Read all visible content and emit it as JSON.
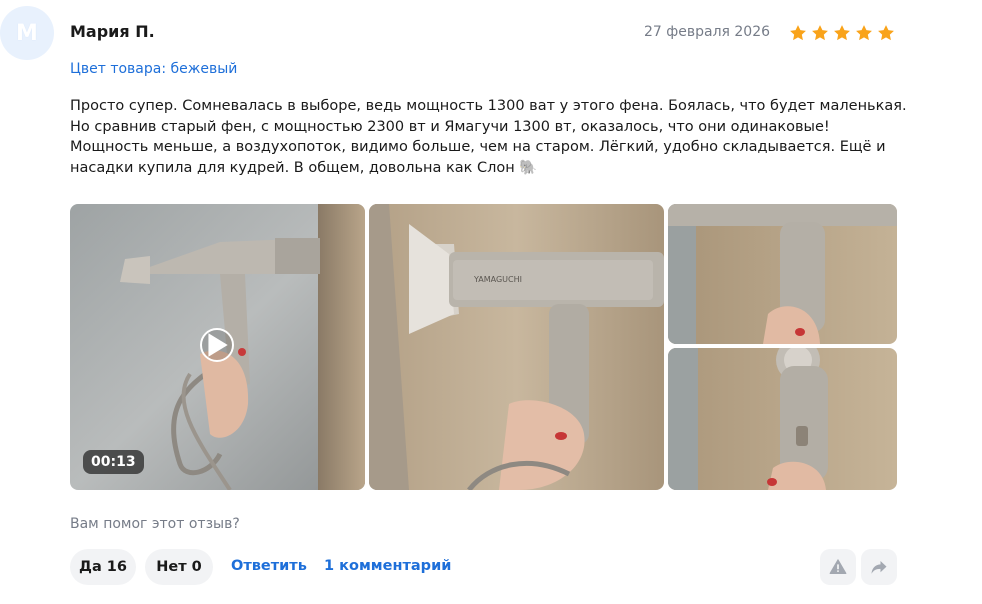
{
  "review": {
    "avatar_letter": "М",
    "author": "Мария П.",
    "date": "27 февраля 2026",
    "rating": 5,
    "color_label": "Цвет товара: бежевый",
    "text": "Просто супер. Сомневалась в выборе, ведь мощность 1300 ват у этого фена. Боялась, что будет маленькая. Но сравнив старый фен, с мощностью 2300 вт и Ямагучи 1300 вт, оказалось, что они одинаковые! Мощность меньше, а воздухопоток, видимо больше, чем на старом. Лёгкий, удобно складывается. Ещё и насадки купила для кудрей. В общем, довольна как Слон 🐘"
  },
  "media": {
    "video_duration": "00:13",
    "brand_on_device": "YAMAGUCHI"
  },
  "footer": {
    "helpful_question": "Вам помог этот отзыв?",
    "yes_label": "Да 16",
    "no_label": "Нет 0",
    "reply_label": "Ответить",
    "comments_label": "1 комментарий"
  },
  "icons": {
    "star": "star-icon",
    "play": "play-icon",
    "report": "warning-icon",
    "share": "share-icon"
  },
  "colors": {
    "accent": "#1e6fd9",
    "star": "#f9a31a",
    "muted": "#767c88",
    "button_bg": "#f2f3f5"
  }
}
